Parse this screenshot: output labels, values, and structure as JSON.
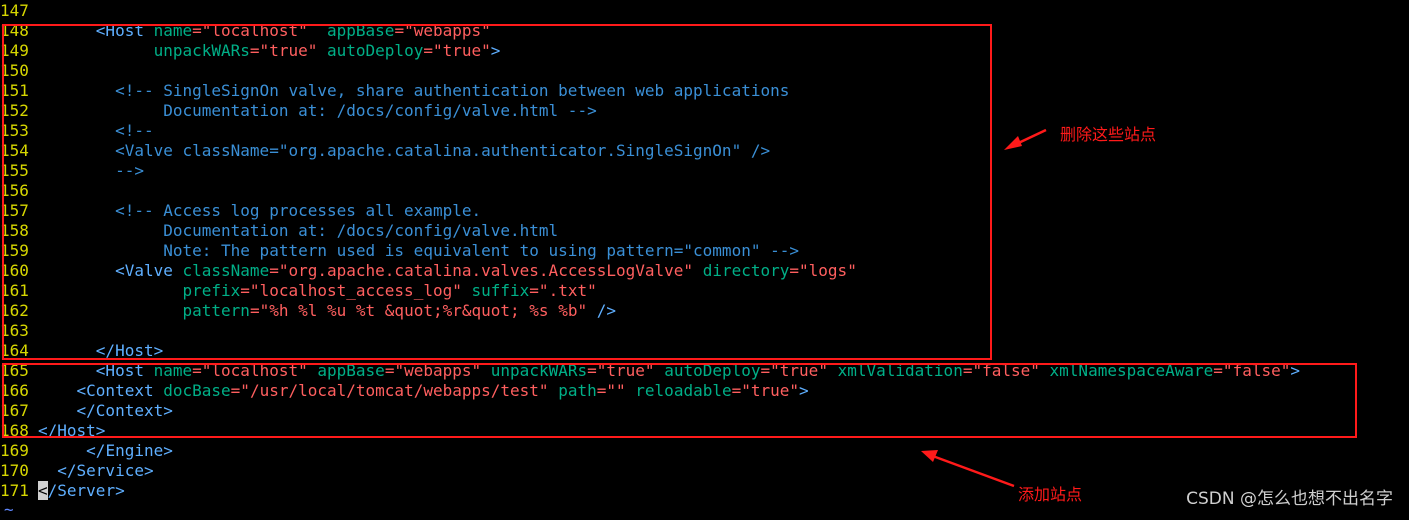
{
  "editor": {
    "lines": [
      {
        "n": "147",
        "tokens": []
      },
      {
        "n": "148",
        "tokens": [
          {
            "t": "      ",
            "k": "txt"
          },
          {
            "t": "<Host",
            "k": "tag"
          },
          {
            "t": " ",
            "k": "txt"
          },
          {
            "t": "name",
            "k": "attr"
          },
          {
            "t": "=\"localhost\"",
            "k": "str"
          },
          {
            "t": "  ",
            "k": "txt"
          },
          {
            "t": "appBase",
            "k": "attr"
          },
          {
            "t": "=\"webapps\"",
            "k": "str"
          }
        ]
      },
      {
        "n": "149",
        "tokens": [
          {
            "t": "            ",
            "k": "txt"
          },
          {
            "t": "unpackWARs",
            "k": "attr"
          },
          {
            "t": "=\"true\"",
            "k": "str"
          },
          {
            "t": " ",
            "k": "txt"
          },
          {
            "t": "autoDeploy",
            "k": "attr"
          },
          {
            "t": "=\"true\"",
            "k": "str"
          },
          {
            "t": ">",
            "k": "tag"
          }
        ]
      },
      {
        "n": "150",
        "tokens": []
      },
      {
        "n": "151",
        "tokens": [
          {
            "t": "        <!-- SingleSignOn valve, share authentication between web applications",
            "k": "com"
          }
        ]
      },
      {
        "n": "152",
        "tokens": [
          {
            "t": "             Documentation at: /docs/config/valve.html -->",
            "k": "com"
          }
        ]
      },
      {
        "n": "153",
        "tokens": [
          {
            "t": "        <!--",
            "k": "com"
          }
        ]
      },
      {
        "n": "154",
        "tokens": [
          {
            "t": "        <Valve className=\"org.apache.catalina.authenticator.SingleSignOn\" />",
            "k": "com"
          }
        ]
      },
      {
        "n": "155",
        "tokens": [
          {
            "t": "        -->",
            "k": "com"
          }
        ]
      },
      {
        "n": "156",
        "tokens": []
      },
      {
        "n": "157",
        "tokens": [
          {
            "t": "        <!-- Access log processes all example.",
            "k": "com"
          }
        ]
      },
      {
        "n": "158",
        "tokens": [
          {
            "t": "             Documentation at: /docs/config/valve.html",
            "k": "com"
          }
        ]
      },
      {
        "n": "159",
        "tokens": [
          {
            "t": "             Note: The pattern used is equivalent to using pattern=\"common\" -->",
            "k": "com"
          }
        ]
      },
      {
        "n": "160",
        "tokens": [
          {
            "t": "        ",
            "k": "txt"
          },
          {
            "t": "<Valve",
            "k": "tag"
          },
          {
            "t": " ",
            "k": "txt"
          },
          {
            "t": "className",
            "k": "attr"
          },
          {
            "t": "=\"org.apache.catalina.valves.AccessLogValve\"",
            "k": "str"
          },
          {
            "t": " ",
            "k": "txt"
          },
          {
            "t": "directory",
            "k": "attr"
          },
          {
            "t": "=\"logs\"",
            "k": "str"
          }
        ]
      },
      {
        "n": "161",
        "tokens": [
          {
            "t": "               ",
            "k": "txt"
          },
          {
            "t": "prefix",
            "k": "attr"
          },
          {
            "t": "=\"localhost_access_log\"",
            "k": "str"
          },
          {
            "t": " ",
            "k": "txt"
          },
          {
            "t": "suffix",
            "k": "attr"
          },
          {
            "t": "=\".txt\"",
            "k": "str"
          }
        ]
      },
      {
        "n": "162",
        "tokens": [
          {
            "t": "               ",
            "k": "txt"
          },
          {
            "t": "pattern",
            "k": "attr"
          },
          {
            "t": "=\"%h %l %u %t &quot;%r&quot; %s %b\"",
            "k": "str"
          },
          {
            "t": " />",
            "k": "tag"
          }
        ]
      },
      {
        "n": "163",
        "tokens": []
      },
      {
        "n": "164",
        "tokens": [
          {
            "t": "      ",
            "k": "txt"
          },
          {
            "t": "</Host>",
            "k": "tag"
          }
        ]
      },
      {
        "n": "165",
        "tokens": [
          {
            "t": "      ",
            "k": "txt"
          },
          {
            "t": "<Host",
            "k": "tag"
          },
          {
            "t": " ",
            "k": "txt"
          },
          {
            "t": "name",
            "k": "attr"
          },
          {
            "t": "=\"localhost\"",
            "k": "str"
          },
          {
            "t": " ",
            "k": "txt"
          },
          {
            "t": "appBase",
            "k": "attr"
          },
          {
            "t": "=\"webapps\"",
            "k": "str"
          },
          {
            "t": " ",
            "k": "txt"
          },
          {
            "t": "unpackWARs",
            "k": "attr"
          },
          {
            "t": "=\"true\"",
            "k": "str"
          },
          {
            "t": " ",
            "k": "txt"
          },
          {
            "t": "autoDeploy",
            "k": "attr"
          },
          {
            "t": "=\"true\"",
            "k": "str"
          },
          {
            "t": " ",
            "k": "txt"
          },
          {
            "t": "xmlValidation",
            "k": "attr"
          },
          {
            "t": "=\"false\"",
            "k": "str"
          },
          {
            "t": " ",
            "k": "txt"
          },
          {
            "t": "xmlNamespaceAware",
            "k": "attr"
          },
          {
            "t": "=\"false\"",
            "k": "str"
          },
          {
            "t": ">",
            "k": "tag"
          }
        ]
      },
      {
        "n": "166",
        "tokens": [
          {
            "t": "    ",
            "k": "txt"
          },
          {
            "t": "<Context",
            "k": "tag"
          },
          {
            "t": " ",
            "k": "txt"
          },
          {
            "t": "docBase",
            "k": "attr"
          },
          {
            "t": "=\"/usr/local/tomcat/webapps/test\"",
            "k": "str"
          },
          {
            "t": " ",
            "k": "txt"
          },
          {
            "t": "path",
            "k": "attr"
          },
          {
            "t": "=\"\"",
            "k": "str"
          },
          {
            "t": " ",
            "k": "txt"
          },
          {
            "t": "reloadable",
            "k": "attr"
          },
          {
            "t": "=\"true\"",
            "k": "str"
          },
          {
            "t": ">",
            "k": "tag"
          }
        ]
      },
      {
        "n": "167",
        "tokens": [
          {
            "t": "    ",
            "k": "txt"
          },
          {
            "t": "</Context>",
            "k": "tag"
          }
        ]
      },
      {
        "n": "168",
        "tokens": [
          {
            "t": "</Host>",
            "k": "tag"
          }
        ]
      },
      {
        "n": "169",
        "tokens": [
          {
            "t": "     ",
            "k": "txt"
          },
          {
            "t": "</Engine>",
            "k": "tag"
          }
        ]
      },
      {
        "n": "170",
        "tokens": [
          {
            "t": "  ",
            "k": "txt"
          },
          {
            "t": "</Service>",
            "k": "tag"
          }
        ]
      },
      {
        "n": "171",
        "tokens": [
          {
            "t": "<",
            "k": "cur"
          },
          {
            "t": "/Server>",
            "k": "tag"
          }
        ]
      }
    ],
    "tilde": "~"
  },
  "annotations": {
    "remove_note": "删除这些站点",
    "add_note": "添加站点",
    "color": "#ff1a1a"
  },
  "watermark": "CSDN @怎么也想不出名字"
}
